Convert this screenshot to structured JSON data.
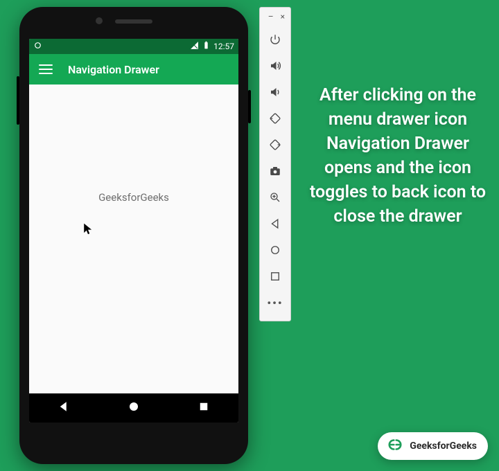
{
  "statusbar": {
    "time": "12:57"
  },
  "appbar": {
    "title": "Navigation Drawer"
  },
  "content": {
    "text": "GeeksforGeeks"
  },
  "caption": {
    "text": "After clicking on the menu drawer icon Navigation Drawer opens and the icon toggles to back icon to close the drawer"
  },
  "brand": {
    "name": "GeeksforGeeks"
  }
}
